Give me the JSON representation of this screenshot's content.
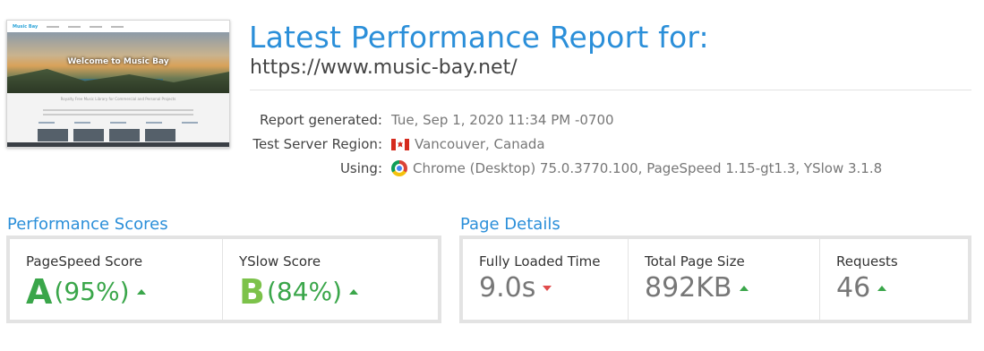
{
  "colors": {
    "accent": "#2b8fd9",
    "grade_a": "#3aa64a",
    "grade_b": "#7cc24a",
    "up": "#3aa64a",
    "down": "#e04b4b"
  },
  "thumbnail": {
    "logo": "Music Bay",
    "hero_text": "Welcome to Music Bay",
    "subtitle": "Royalty Free Music Library for Commercial and Personal Projects"
  },
  "header": {
    "title": "Latest Performance Report for:",
    "url": "https://www.music-bay.net/"
  },
  "meta": {
    "report_generated_label": "Report generated:",
    "report_generated_value": "Tue, Sep 1, 2020 11:34 PM -0700",
    "region_label": "Test Server Region:",
    "region_icon": "canada-flag-icon",
    "region_value": "Vancouver, Canada",
    "using_label": "Using:",
    "using_icon": "chrome-icon",
    "using_value": "Chrome (Desktop) 75.0.3770.100, PageSpeed 1.15-gt1.3, YSlow 3.1.8"
  },
  "performance": {
    "title": "Performance Scores",
    "pagespeed": {
      "label": "PageSpeed Score",
      "grade": "A",
      "percent": "(95%)",
      "trend": "up"
    },
    "yslow": {
      "label": "YSlow Score",
      "grade": "B",
      "percent": "(84%)",
      "trend": "up"
    }
  },
  "details": {
    "title": "Page Details",
    "load_time": {
      "label": "Fully Loaded Time",
      "value": "9.0s",
      "trend": "down"
    },
    "page_size": {
      "label": "Total Page Size",
      "value": "892KB",
      "trend": "up"
    },
    "requests": {
      "label": "Requests",
      "value": "46",
      "trend": "up"
    }
  }
}
